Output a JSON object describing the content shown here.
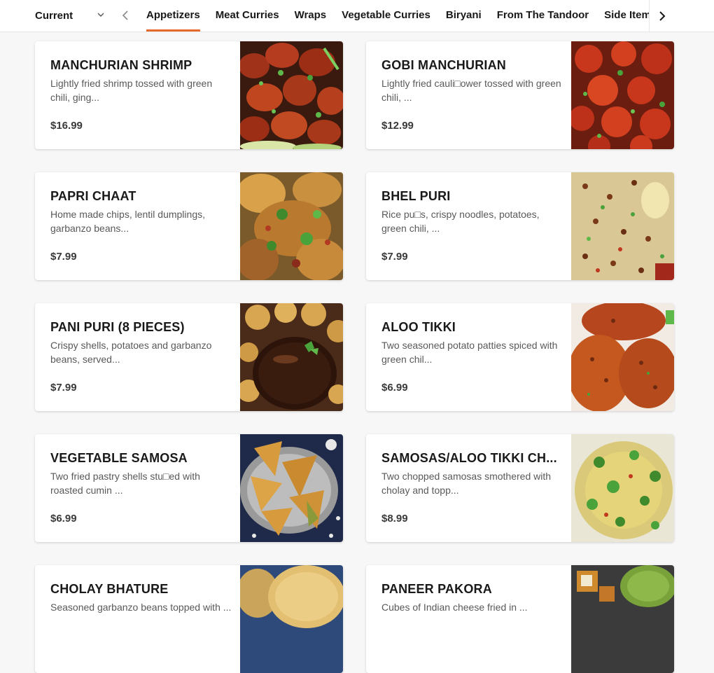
{
  "nav": {
    "menu_selector_label": "Current",
    "tabs": [
      {
        "label": "Appetizers",
        "active": true
      },
      {
        "label": "Meat Curries",
        "active": false
      },
      {
        "label": "Wraps",
        "active": false
      },
      {
        "label": "Vegetable Curries",
        "active": false
      },
      {
        "label": "Biryani",
        "active": false
      },
      {
        "label": "From The Tandoor",
        "active": false
      },
      {
        "label": "Side Items",
        "active": false
      }
    ]
  },
  "colors": {
    "accent": "#e8692c",
    "page_background": "#f7f7f7",
    "card_background": "#ffffff"
  },
  "items": [
    {
      "name": "MANCHURIAN SHRIMP",
      "description": "Lightly fried shrimp tossed with green chili, ging...",
      "price": "$16.99",
      "photo": "manchurian-shrimp-photo"
    },
    {
      "name": "GOBI MANCHURIAN",
      "description": "Lightly fried cauli□ower tossed with green chili, ...",
      "price": "$12.99",
      "photo": "gobi-manchurian-photo"
    },
    {
      "name": "PAPRI CHAAT",
      "description": "Home made chips, lentil dumplings, garbanzo beans...",
      "price": "$7.99",
      "photo": "papri-chaat-photo"
    },
    {
      "name": "BHEL PURI",
      "description": "Rice pu□s, crispy noodles, potatoes, green chili, ...",
      "price": "$7.99",
      "photo": "bhel-puri-photo"
    },
    {
      "name": "PANI PURI (8 PIECES)",
      "description": "Crispy shells, potatoes and garbanzo beans, served...",
      "price": "$7.99",
      "photo": "pani-puri-photo"
    },
    {
      "name": "ALOO TIKKI",
      "description": "Two seasoned potato patties spiced with green chil...",
      "price": "$6.99",
      "photo": "aloo-tikki-photo"
    },
    {
      "name": "VEGETABLE SAMOSA",
      "description": "Two fried pastry shells stu□ed with roasted cumin ...",
      "price": "$6.99",
      "photo": "vegetable-samosa-photo"
    },
    {
      "name": "SAMOSAS/ALOO TIKKI CH...",
      "description": "Two chopped samosas smothered with cholay and topp...",
      "price": "$8.99",
      "photo": "samosa-chaat-photo"
    },
    {
      "name": "CHOLAY BHATURE",
      "description": "Seasoned garbanzo beans topped with ...",
      "price": "",
      "photo": "cholay-bhature-photo"
    },
    {
      "name": "PANEER PAKORA",
      "description": "Cubes of Indian cheese fried in ...",
      "price": "",
      "photo": "paneer-pakora-photo"
    }
  ]
}
